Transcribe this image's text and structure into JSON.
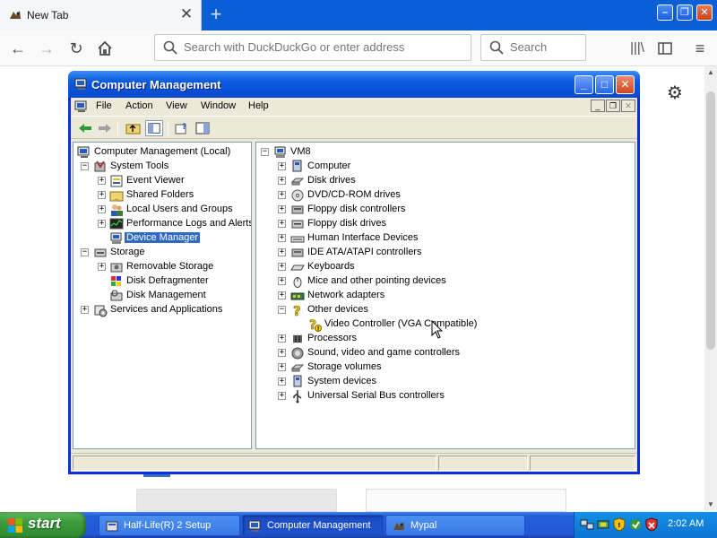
{
  "browser": {
    "tab_title": "New Tab",
    "url_placeholder": "Search with DuckDuckGo or enter address",
    "search_placeholder": "Search"
  },
  "window": {
    "title": "Computer Management",
    "menu": [
      "File",
      "Action",
      "View",
      "Window",
      "Help"
    ]
  },
  "left_tree": [
    {
      "label": "Computer Management (Local)",
      "icon": "computer-management-icon"
    },
    {
      "label": "System Tools",
      "icon": "system-tools-icon"
    },
    {
      "label": "Event Viewer",
      "icon": "event-viewer-icon"
    },
    {
      "label": "Shared Folders",
      "icon": "shared-folders-icon"
    },
    {
      "label": "Local Users and Groups",
      "icon": "users-icon"
    },
    {
      "label": "Performance Logs and Alerts",
      "icon": "performance-icon"
    },
    {
      "label": "Device Manager",
      "icon": "device-manager-icon"
    },
    {
      "label": "Storage",
      "icon": "storage-icon"
    },
    {
      "label": "Removable Storage",
      "icon": "removable-storage-icon"
    },
    {
      "label": "Disk Defragmenter",
      "icon": "defrag-icon"
    },
    {
      "label": "Disk Management",
      "icon": "disk-management-icon"
    },
    {
      "label": "Services and Applications",
      "icon": "services-icon"
    }
  ],
  "right_tree": [
    {
      "label": "VM8",
      "icon": "computer-icon"
    },
    {
      "label": "Computer",
      "icon": "computer-icon"
    },
    {
      "label": "Disk drives",
      "icon": "disk-drive-icon"
    },
    {
      "label": "DVD/CD-ROM drives",
      "icon": "cdrom-icon"
    },
    {
      "label": "Floppy disk controllers",
      "icon": "floppy-controller-icon"
    },
    {
      "label": "Floppy disk drives",
      "icon": "floppy-drive-icon"
    },
    {
      "label": "Human Interface Devices",
      "icon": "hid-icon"
    },
    {
      "label": "IDE ATA/ATAPI controllers",
      "icon": "ide-controller-icon"
    },
    {
      "label": "Keyboards",
      "icon": "keyboard-icon"
    },
    {
      "label": "Mice and other pointing devices",
      "icon": "mouse-icon"
    },
    {
      "label": "Network adapters",
      "icon": "network-adapter-icon"
    },
    {
      "label": "Other devices",
      "icon": "unknown-device-icon"
    },
    {
      "label": "Video Controller (VGA Compatible)",
      "icon": "warning-device-icon"
    },
    {
      "label": "Processors",
      "icon": "processor-icon"
    },
    {
      "label": "Sound, video and game controllers",
      "icon": "sound-icon"
    },
    {
      "label": "Storage volumes",
      "icon": "storage-volume-icon"
    },
    {
      "label": "System devices",
      "icon": "system-devices-icon"
    },
    {
      "label": "Universal Serial Bus controllers",
      "icon": "usb-icon"
    }
  ],
  "taskbar": {
    "start_label": "start",
    "tasks": [
      "Half-Life(R) 2 Setup",
      "Computer Management",
      "Mypal"
    ],
    "clock": "2:02 AM"
  },
  "colors": {
    "xp_title_blue": "#0a5bdf",
    "selection": "#316ac5",
    "taskbar_blue": "#245edb",
    "start_green": "#3c9a3c"
  }
}
